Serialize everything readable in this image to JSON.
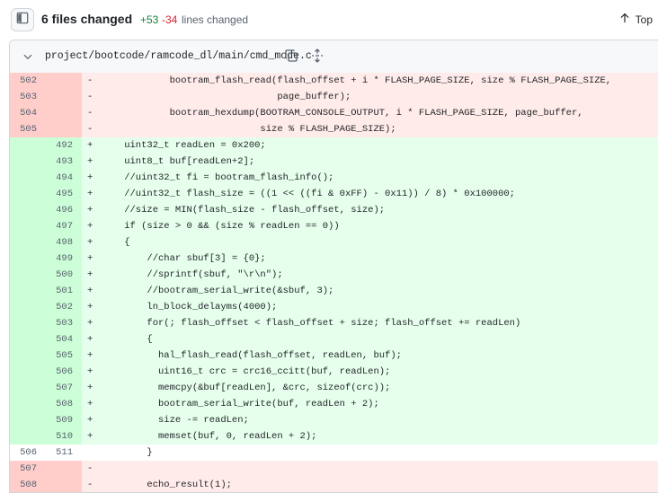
{
  "summary": {
    "files_changed": "6 files changed",
    "additions": "+53",
    "deletions": "-34",
    "lines_changed": "lines changed",
    "top_label": "Top"
  },
  "file": {
    "path": "project/bootcode/ramcode_dl/main/cmd_mode.c",
    "icons": [
      "chevron-down-icon",
      "copy-icon",
      "expand-icon",
      "arrow-up-icon",
      "sidebar-toggle-icon"
    ]
  },
  "colors": {
    "del_bg": "#ffebe9",
    "del_gutter": "#ffcecb",
    "add_bg": "#e6ffec",
    "add_gutter": "#ccffd8",
    "add_text": "#1a7f37",
    "del_text": "#cf222e"
  },
  "lines": [
    {
      "type": "del",
      "old": "502",
      "new": "",
      "sign": "-",
      "code": "            bootram_flash_read(flash_offset + i * FLASH_PAGE_SIZE, size % FLASH_PAGE_SIZE,"
    },
    {
      "type": "del",
      "old": "503",
      "new": "",
      "sign": "-",
      "code": "                               page_buffer);"
    },
    {
      "type": "del",
      "old": "504",
      "new": "",
      "sign": "-",
      "code": "            bootram_hexdump(BOOTRAM_CONSOLE_OUTPUT, i * FLASH_PAGE_SIZE, page_buffer,"
    },
    {
      "type": "del",
      "old": "505",
      "new": "",
      "sign": "-",
      "code": "                            size % FLASH_PAGE_SIZE);"
    },
    {
      "type": "add",
      "old": "",
      "new": "492",
      "sign": "+",
      "code": "    uint32_t readLen = 0x200;"
    },
    {
      "type": "add",
      "old": "",
      "new": "493",
      "sign": "+",
      "code": "    uint8_t buf[readLen+2];"
    },
    {
      "type": "add",
      "old": "",
      "new": "494",
      "sign": "+",
      "code": "    //uint32_t fi = bootram_flash_info();"
    },
    {
      "type": "add",
      "old": "",
      "new": "495",
      "sign": "+",
      "code": "    //uint32_t flash_size = ((1 << ((fi & 0xFF) - 0x11)) / 8) * 0x100000;"
    },
    {
      "type": "add",
      "old": "",
      "new": "496",
      "sign": "+",
      "code": "    //size = MIN(flash_size - flash_offset, size);"
    },
    {
      "type": "add",
      "old": "",
      "new": "497",
      "sign": "+",
      "code": "    if (size > 0 && (size % readLen == 0))"
    },
    {
      "type": "add",
      "old": "",
      "new": "498",
      "sign": "+",
      "code": "    {"
    },
    {
      "type": "add",
      "old": "",
      "new": "499",
      "sign": "+",
      "code": "        //char sbuf[3] = {0};"
    },
    {
      "type": "add",
      "old": "",
      "new": "500",
      "sign": "+",
      "code": "        //sprintf(sbuf, \"\\r\\n\");"
    },
    {
      "type": "add",
      "old": "",
      "new": "501",
      "sign": "+",
      "code": "        //bootram_serial_write(&sbuf, 3);"
    },
    {
      "type": "add",
      "old": "",
      "new": "502",
      "sign": "+",
      "code": "        ln_block_delayms(4000);"
    },
    {
      "type": "add",
      "old": "",
      "new": "503",
      "sign": "+",
      "code": "        for(; flash_offset < flash_offset + size; flash_offset += readLen)"
    },
    {
      "type": "add",
      "old": "",
      "new": "504",
      "sign": "+",
      "code": "        {"
    },
    {
      "type": "add",
      "old": "",
      "new": "505",
      "sign": "+",
      "code": "          hal_flash_read(flash_offset, readLen, buf);"
    },
    {
      "type": "add",
      "old": "",
      "new": "506",
      "sign": "+",
      "code": "          uint16_t crc = crc16_ccitt(buf, readLen);"
    },
    {
      "type": "add",
      "old": "",
      "new": "507",
      "sign": "+",
      "code": "          memcpy(&buf[readLen], &crc, sizeof(crc));"
    },
    {
      "type": "add",
      "old": "",
      "new": "508",
      "sign": "+",
      "code": "          bootram_serial_write(buf, readLen + 2);"
    },
    {
      "type": "add",
      "old": "",
      "new": "509",
      "sign": "+",
      "code": "          size -= readLen;"
    },
    {
      "type": "add",
      "old": "",
      "new": "510",
      "sign": "+",
      "code": "          memset(buf, 0, readLen + 2);"
    },
    {
      "type": "ctx",
      "old": "506",
      "new": "511",
      "sign": "",
      "code": "        }"
    },
    {
      "type": "del",
      "old": "507",
      "new": "",
      "sign": "-",
      "code": ""
    },
    {
      "type": "del",
      "old": "508",
      "new": "",
      "sign": "-",
      "code": "        echo_result(1);"
    }
  ]
}
